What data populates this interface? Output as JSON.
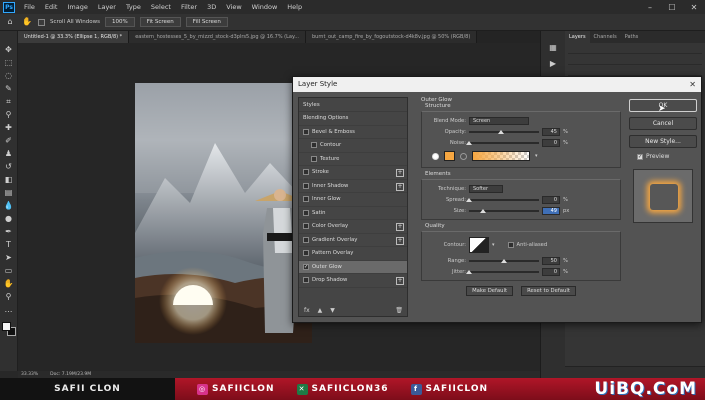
{
  "app": {
    "logo": "Ps"
  },
  "menu": [
    "File",
    "Edit",
    "Image",
    "Layer",
    "Type",
    "Select",
    "Filter",
    "3D",
    "View",
    "Window",
    "Help"
  ],
  "options": {
    "scroll_all": "Scroll All Windows",
    "zoom_btn": "100%",
    "fit_btn": "Fit Screen",
    "fill_btn": "Fill Screen"
  },
  "tabs": [
    "Untitled-1 @ 33.3% (Ellipse 1, RGB/8) *",
    "eastern_hostesses_5_by_mizzd_stock-d3plrs5.jpg @ 16.7% (Lay...",
    "burnt_out_camp_fire_by_fogoutstock-d4k8v.jpg @ 50% (RGB/8)"
  ],
  "status": {
    "zoom": "33.33%",
    "doc": "Doc: 7.19M/23.9M"
  },
  "panel": {
    "tabs": [
      "Layers",
      "Channels",
      "Paths"
    ]
  },
  "dialog": {
    "title": "Layer Style",
    "list_header": "Styles",
    "styles": [
      {
        "label": "Blending Options",
        "checkbox": false,
        "plus": false,
        "indent": false,
        "checked": false,
        "selected": false
      },
      {
        "label": "Bevel & Emboss",
        "checkbox": true,
        "plus": false,
        "indent": false,
        "checked": false,
        "selected": false
      },
      {
        "label": "Contour",
        "checkbox": true,
        "plus": false,
        "indent": true,
        "checked": false,
        "selected": false
      },
      {
        "label": "Texture",
        "checkbox": true,
        "plus": false,
        "indent": true,
        "checked": false,
        "selected": false
      },
      {
        "label": "Stroke",
        "checkbox": true,
        "plus": true,
        "indent": false,
        "checked": false,
        "selected": false
      },
      {
        "label": "Inner Shadow",
        "checkbox": true,
        "plus": true,
        "indent": false,
        "checked": false,
        "selected": false
      },
      {
        "label": "Inner Glow",
        "checkbox": true,
        "plus": false,
        "indent": false,
        "checked": false,
        "selected": false
      },
      {
        "label": "Satin",
        "checkbox": true,
        "plus": false,
        "indent": false,
        "checked": false,
        "selected": false
      },
      {
        "label": "Color Overlay",
        "checkbox": true,
        "plus": true,
        "indent": false,
        "checked": false,
        "selected": false
      },
      {
        "label": "Gradient Overlay",
        "checkbox": true,
        "plus": true,
        "indent": false,
        "checked": false,
        "selected": false
      },
      {
        "label": "Pattern Overlay",
        "checkbox": true,
        "plus": false,
        "indent": false,
        "checked": false,
        "selected": false
      },
      {
        "label": "Outer Glow",
        "checkbox": true,
        "plus": false,
        "indent": false,
        "checked": true,
        "selected": true
      },
      {
        "label": "Drop Shadow",
        "checkbox": true,
        "plus": true,
        "indent": false,
        "checked": false,
        "selected": false
      }
    ],
    "footer_fx": "fx",
    "outer_glow": {
      "title": "Outer Glow",
      "structure": {
        "title": "Structure",
        "blend_mode_label": "Blend Mode:",
        "blend_mode": "Screen",
        "opacity_label": "Opacity:",
        "opacity": 45,
        "noise_label": "Noise:",
        "noise": 0,
        "unit": "%"
      },
      "elements": {
        "title": "Elements",
        "technique_label": "Technique:",
        "technique": "Softer",
        "spread_label": "Spread:",
        "spread": 0,
        "spread_unit": "%",
        "size_label": "Size:",
        "size": 49,
        "size_unit": "px"
      },
      "quality": {
        "title": "Quality",
        "contour_label": "Contour:",
        "anti_aliased": "Anti-aliased",
        "range_label": "Range:",
        "range": 50,
        "range_unit": "%",
        "jitter_label": "Jitter:",
        "jitter": 0,
        "jitter_unit": "%"
      },
      "make_default": "Make Default",
      "reset_default": "Reset to Default"
    },
    "buttons": {
      "ok": "OK",
      "cancel": "Cancel",
      "new_style": "New Style...",
      "preview": "Preview"
    },
    "glow_color": "#f7a741"
  },
  "banner": {
    "left": "SAFII CLON",
    "instagram": "SAFIICLON",
    "xsplit": "SAFIICLON36",
    "facebook": "SAFIICLON",
    "watermark": "UiBQ.CoM"
  }
}
